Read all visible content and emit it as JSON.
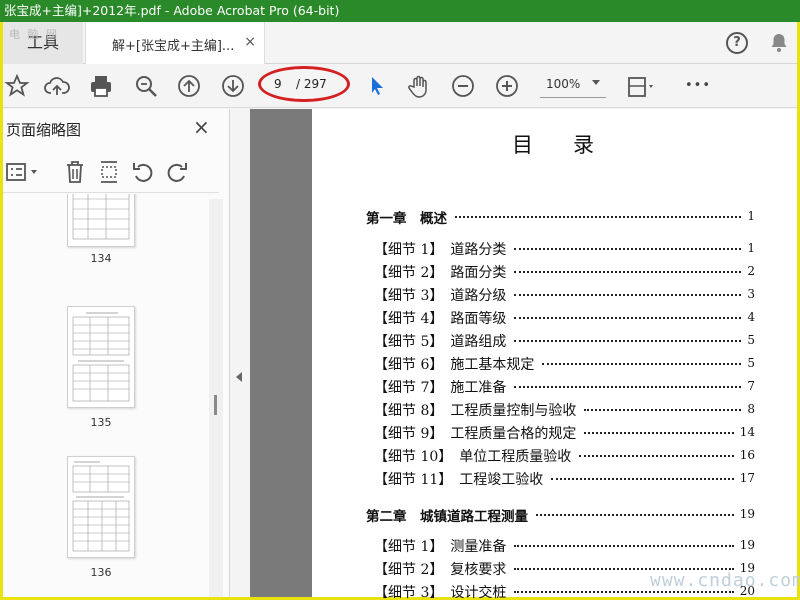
{
  "window": {
    "title": "张宝成+主编]+2012年.pdf - Adobe Acrobat Pro (64-bit)"
  },
  "tabs": {
    "tools_label": "工具",
    "doc_label": "解+[张宝成+主编]...",
    "close_glyph": "×",
    "watermark": "电 脑 网"
  },
  "toolbar": {
    "page_current": "9",
    "page_total": "/ 297",
    "zoom": "100%",
    "more_glyph": "•••"
  },
  "sidebar": {
    "title": "页面缩略图",
    "close_glyph": "×",
    "thumbnails": [
      {
        "label": "134"
      },
      {
        "label": "135"
      },
      {
        "label": "136"
      }
    ]
  },
  "document": {
    "title": "目录",
    "toc": [
      {
        "text": "第一章　概述",
        "page": "1",
        "kind": "chapter"
      },
      {
        "text": "【细节 1】　道路分类",
        "page": "1",
        "kind": "item"
      },
      {
        "text": "【细节 2】　路面分类",
        "page": "2",
        "kind": "item"
      },
      {
        "text": "【细节 3】　道路分级",
        "page": "3",
        "kind": "item"
      },
      {
        "text": "【细节 4】　路面等级",
        "page": "4",
        "kind": "item"
      },
      {
        "text": "【细节 5】　道路组成",
        "page": "5",
        "kind": "item"
      },
      {
        "text": "【细节 6】　施工基本规定",
        "page": "5",
        "kind": "item"
      },
      {
        "text": "【细节 7】　施工准备",
        "page": "7",
        "kind": "item"
      },
      {
        "text": "【细节 8】　工程质量控制与验收",
        "page": "8",
        "kind": "item"
      },
      {
        "text": "【细节 9】　工程质量合格的规定",
        "page": "14",
        "kind": "item"
      },
      {
        "text": "【细节 10】　单位工程质量验收",
        "page": "16",
        "kind": "item"
      },
      {
        "text": "【细节 11】　工程竣工验收",
        "page": "17",
        "kind": "item"
      },
      {
        "text": "第二章　城镇道路工程测量",
        "page": "19",
        "kind": "chapter"
      },
      {
        "text": "【细节 1】　测量准备",
        "page": "19",
        "kind": "item"
      },
      {
        "text": "【细节 2】　复核要求",
        "page": "19",
        "kind": "item"
      },
      {
        "text": "【细节 3】　设计交桩",
        "page": "20",
        "kind": "item"
      }
    ]
  },
  "watermark_br": "www.cndao.com",
  "colors": {
    "titlebar": "#2a8a2a",
    "frame": "#e8e20e",
    "annotation": "#d32020",
    "select_tool": "#1d6fd8"
  }
}
